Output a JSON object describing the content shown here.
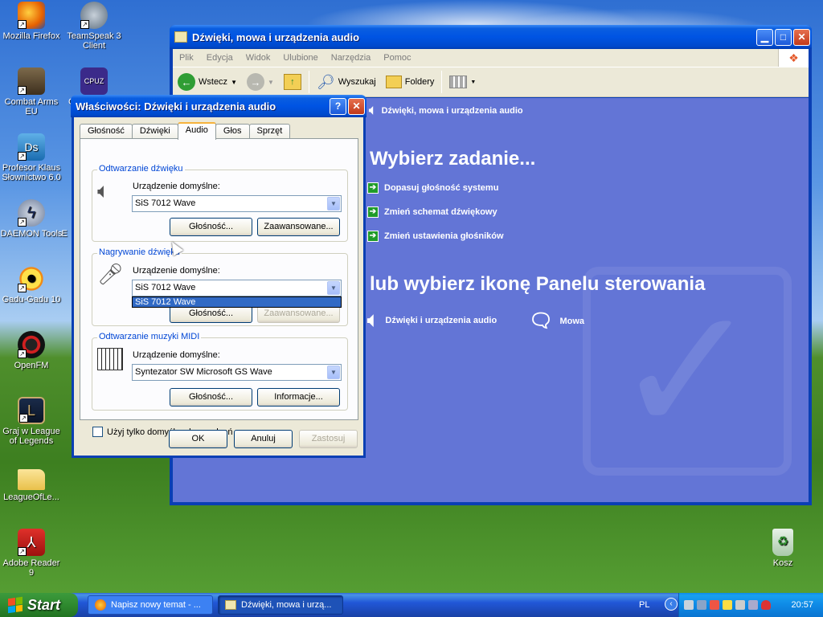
{
  "desktop": {
    "icons": [
      {
        "label": "Mozilla Firefox",
        "icon": "firefox-icon"
      },
      {
        "label": "TeamSpeak 3 Client",
        "icon": "teamspeak-icon"
      },
      {
        "label": "Combat Arms EU",
        "icon": "combat-arms-icon"
      },
      {
        "label": "Profesor Klaus Słownictwo 6.0",
        "icon": "profesor-klaus-icon"
      },
      {
        "label": "DAEMON Tools",
        "icon": "daemon-tools-icon"
      },
      {
        "label": "Gadu-Gadu 10",
        "icon": "gadu-gadu-icon"
      },
      {
        "label": "OpenFM",
        "icon": "openfm-icon"
      },
      {
        "label": "Graj w League of Legends",
        "icon": "league-icon"
      },
      {
        "label": "LeagueOfLe...",
        "icon": "folder-icon"
      },
      {
        "label": "Adobe Reader 9",
        "icon": "adobe-reader-icon"
      },
      {
        "label": "Kosz",
        "icon": "recycle-bin-icon"
      }
    ],
    "partial_labels": {
      "cpuz": "C",
      "daemon_extra": "E"
    }
  },
  "explorer": {
    "title": "Dźwięki, mowa i urządzenia audio",
    "menu": [
      "Plik",
      "Edycja",
      "Widok",
      "Ulubione",
      "Narzędzia",
      "Pomoc"
    ],
    "toolbar": {
      "back": "Wstecz",
      "search": "Wyszukaj",
      "folders": "Foldery"
    },
    "panel_title": "Dźwięki, mowa i urządzenia audio",
    "heading1": "Wybierz zadanie...",
    "tasks": [
      "Dopasuj głośność systemu",
      "Zmień schemat dźwiękowy",
      "Zmień ustawienia głośników"
    ],
    "heading2": "lub wybierz ikonę Panelu sterowania",
    "cp_icons": [
      "Dźwięki i urządzenia audio",
      "Mowa"
    ]
  },
  "dialog": {
    "title": "Właściwości: Dźwięki i urządzenia audio",
    "tabs": [
      "Głośność",
      "Dźwięki",
      "Audio",
      "Głos",
      "Sprzęt"
    ],
    "active_tab": "Audio",
    "playback": {
      "group": "Odtwarzanie dźwięku",
      "label": "Urządzenie domyślne:",
      "device": "SiS 7012 Wave",
      "volume_btn": "Głośność...",
      "advanced_btn": "Zaawansowane..."
    },
    "recording": {
      "group": "Nagrywanie dźwięku",
      "label": "Urządzenie domyślne:",
      "device": "SiS 7012 Wave",
      "dropdown_option": "SiS 7012 Wave",
      "volume_btn": "Głośność...",
      "advanced_btn": "Zaawansowane..."
    },
    "midi": {
      "group": "Odtwarzanie muzyki MIDI",
      "label": "Urządzenie domyślne:",
      "device": "Syntezator SW Microsoft GS Wave",
      "volume_btn": "Głośność...",
      "info_btn": "Informacje..."
    },
    "checkbox": "Użyj tylko domyślnych urządzeń",
    "ok": "OK",
    "cancel": "Anuluj",
    "apply": "Zastosuj"
  },
  "taskbar": {
    "start": "Start",
    "items": [
      "Napisz nowy temat - ...",
      "Dźwięki, mowa i urzą..."
    ],
    "lang": "PL",
    "clock": "20:57"
  }
}
